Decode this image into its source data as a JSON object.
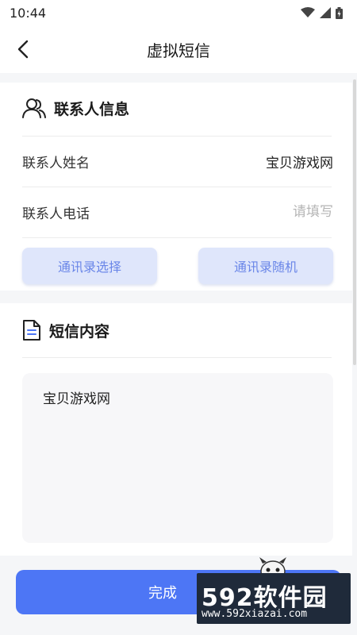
{
  "status_bar": {
    "time": "10:44"
  },
  "nav": {
    "title": "虚拟短信"
  },
  "contact": {
    "section_title": "联系人信息",
    "name_label": "联系人姓名",
    "name_value": "宝贝游戏网",
    "phone_label": "联系人电话",
    "phone_placeholder": "请填写",
    "btn_choose": "通讯录选择",
    "btn_random": "通讯录随机"
  },
  "sms": {
    "section_title": "短信内容",
    "content": "宝贝游戏网"
  },
  "footer": {
    "submit_label": "完成"
  },
  "watermark": {
    "brand": "592软件园",
    "url": "www.592xiazai.com"
  },
  "colors": {
    "primary": "#4d76f5",
    "pill_bg": "#dfe6fb",
    "pill_text": "#6a86e8"
  }
}
